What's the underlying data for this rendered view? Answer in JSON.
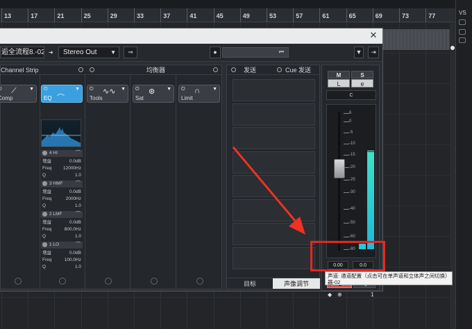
{
  "ruler": {
    "marks": [
      "13",
      "17",
      "21",
      "25",
      "29",
      "33",
      "37",
      "41",
      "45",
      "49",
      "53",
      "57",
      "61",
      "65",
      "69",
      "73",
      "77"
    ]
  },
  "right_panel": {
    "label": "VS"
  },
  "window": {
    "close_glyph": "✕",
    "track_name": "逅全流程8.-02",
    "output": "Stereo Out",
    "output_chevron": "▼",
    "rewind_glyph": "⏮",
    "menu_glyph": "▼"
  },
  "panels": {
    "channel_strip": {
      "title": "Channel Strip"
    },
    "eq_panel": {
      "title": "均衡器"
    },
    "slots": [
      {
        "label": "Comp",
        "glyph": "⟋"
      },
      {
        "label": "EQ",
        "glyph": "︵"
      },
      {
        "label": "Tools",
        "glyph": "∿∿"
      },
      {
        "label": "Sat",
        "glyph": "⊛"
      },
      {
        "label": "Limit",
        "glyph": "∩"
      }
    ],
    "eq_bands": [
      {
        "name": "4 HI",
        "gain_label": "增益",
        "gain": "0.0dB",
        "freq_label": "Freq",
        "freq": "12000Hz",
        "q_label": "Q",
        "q": "1.0"
      },
      {
        "name": "3 HMF",
        "gain_label": "增益",
        "gain": "0.0dB",
        "freq_label": "Freq",
        "freq": "2000Hz",
        "q_label": "Q",
        "q": "1.0"
      },
      {
        "name": "2 LMF",
        "gain_label": "增益",
        "gain": "0.0dB",
        "freq_label": "Freq",
        "freq": "800.0Hz",
        "q_label": "Q",
        "q": "1.0"
      },
      {
        "name": "1 LO",
        "gain_label": "增益",
        "gain": "0.0dB",
        "freq_label": "Freq",
        "freq": "100.0Hz",
        "q_label": "Q",
        "q": "1.0"
      }
    ],
    "sends": {
      "tab_sends": "发送",
      "tab_cue": "Cue 发送",
      "bottom_a": "目标",
      "bottom_b": "声像调节"
    }
  },
  "fader": {
    "mute": "M",
    "solo": "S",
    "listen": "L",
    "edit": "e",
    "pan_value": "C",
    "scale": [
      "6",
      "0",
      "-5",
      "-10",
      "-15",
      "-20",
      "-25",
      "-30",
      "-40",
      "-50",
      "-60",
      "-80"
    ],
    "volume": "0.00",
    "peak": "0.0",
    "monitor_glyph": "◀)",
    "channel_number": "1"
  },
  "tooltip": {
    "line1": "声道: 通道配置（点击可在单声道和立体声之间切换）",
    "line2": "器-02"
  }
}
